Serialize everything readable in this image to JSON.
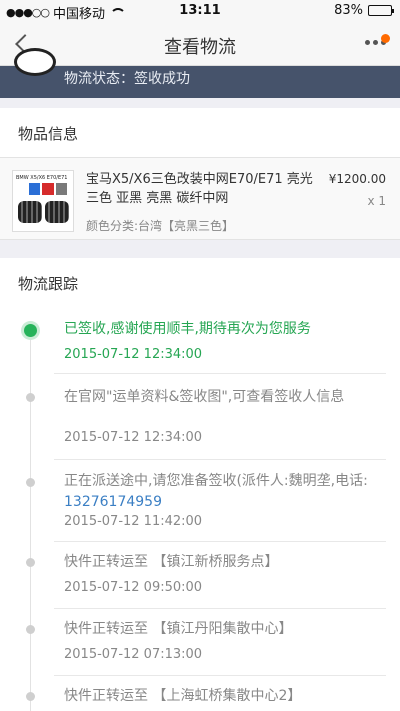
{
  "status_bar": {
    "signal": "●●●○○",
    "carrier": "中国移动",
    "time": "13:11",
    "battery": "83%",
    "battery_level": 0.83
  },
  "nav": {
    "title": "查看物流"
  },
  "logistics_status": "物流状态：签收成功",
  "goods_section": {
    "title": "物品信息",
    "product": {
      "name": "宝马X5/X6三色改装中网E70/E71 亮光三色 亚黑 亮黑 碳纤中网",
      "price": "¥1200.00",
      "quantity": "x 1",
      "variant": "颜色分类:台湾【亮黑三色】",
      "thumb_label": "BMW X5/X6 E70/E71"
    }
  },
  "tracking_section": {
    "title": "物流跟踪",
    "events": [
      {
        "message": "已签收,感谢使用顺丰,期待再次为您服务",
        "time": "2015-07-12 12:34:00",
        "active": true
      },
      {
        "message": "在官网\"运单资料&签收图\",可查看签收人信息",
        "time": "2015-07-12 12:34:00"
      },
      {
        "message": "正在派送途中,请您准备签收(派件人:魏明垄,电话:",
        "phone": "13276174959",
        "time": "2015-07-12 11:42:00"
      },
      {
        "message": "快件正转运至 【镇江新桥服务点】",
        "time": "2015-07-12 09:50:00"
      },
      {
        "message": "快件正转运至 【镇江丹阳集散中心】",
        "time": "2015-07-12 07:13:00"
      },
      {
        "message": "快件正转运至 【上海虹桥集散中心2】",
        "time": ""
      }
    ]
  },
  "colors": {
    "accent_green": "#26a653",
    "banner_bg": "#46536b",
    "link_blue": "#3b7fc4",
    "badge_orange": "#ff6a00"
  }
}
